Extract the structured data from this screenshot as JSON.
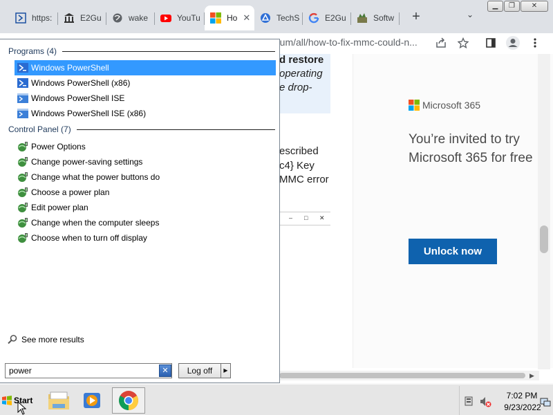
{
  "browser": {
    "tabs": [
      {
        "label": "https:",
        "icon": "terminal-icon"
      },
      {
        "label": "E2Gu",
        "icon": "bank-icon"
      },
      {
        "label": "wake",
        "icon": "globe-icon"
      },
      {
        "label": "YouTu",
        "icon": "youtube-icon"
      },
      {
        "label": "Ho",
        "icon": "microsoft-icon",
        "active": true
      },
      {
        "label": "TechS",
        "icon": "techspot-icon"
      },
      {
        "label": "E2Gu",
        "icon": "google-icon"
      },
      {
        "label": "Softw",
        "icon": "software-icon"
      }
    ],
    "tab_close": "✕",
    "new_tab": "+",
    "tab_list": "⌄",
    "window_controls": {
      "minimize": "▁",
      "restore": "❐",
      "close": "✕"
    },
    "url": "rum/all/how-to-fix-mmc-could-n..."
  },
  "page": {
    "article_lines": [
      {
        "text": "d restore",
        "style": "bold"
      },
      {
        "text": "operating",
        "style": "italic"
      },
      {
        "text": "e drop-",
        "style": "italic"
      },
      {
        "text": "escribed",
        "style": "normal"
      },
      {
        "text": "c4} Key",
        "style": "normal"
      },
      {
        "text": "MMC error",
        "style": "normal"
      }
    ],
    "mini_window_controls": {
      "min": "–",
      "max": "□",
      "close": "✕"
    },
    "ad": {
      "brand": "Microsoft 365",
      "headline": "You’re invited to try Microsoft 365 for free",
      "cta": "Unlock now"
    }
  },
  "start_menu": {
    "programs_header": "Programs (4)",
    "programs": [
      {
        "label": "Windows PowerShell",
        "selected": true
      },
      {
        "label": "Windows PowerShell (x86)"
      },
      {
        "label": "Windows PowerShell ISE"
      },
      {
        "label": "Windows PowerShell ISE (x86)"
      }
    ],
    "control_panel_header": "Control Panel (7)",
    "control_panel": [
      {
        "label": "Power Options"
      },
      {
        "label": "Change power-saving settings"
      },
      {
        "label": "Change what the power buttons do"
      },
      {
        "label": "Choose a power plan"
      },
      {
        "label": "Edit power plan"
      },
      {
        "label": "Change when the computer sleeps"
      },
      {
        "label": "Choose when to turn off display"
      }
    ],
    "see_more": "See more results",
    "search_value": "power",
    "search_clear": "✕",
    "log_off": "Log off",
    "log_off_arrow": "▶"
  },
  "taskbar": {
    "start_label": "Start",
    "apps": [
      "file-explorer-icon",
      "media-player-icon",
      "chrome-icon"
    ],
    "time": "7:02 PM",
    "date": "9/23/2022"
  },
  "colors": {
    "selection": "#3399ff",
    "ad_button": "#0f62ae",
    "tabstrip": "#dee1e6"
  }
}
